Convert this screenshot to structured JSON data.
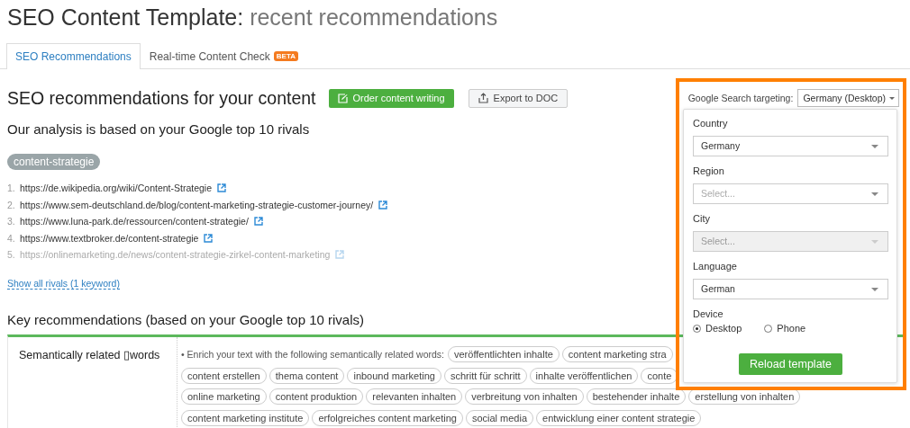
{
  "page_title": {
    "main": "SEO Content Template:",
    "sub": "recent recommendations"
  },
  "tabs": [
    {
      "label": "SEO Recommendations",
      "selected": true
    },
    {
      "label": "Real-time Content Check",
      "selected": false,
      "badge": "BETA"
    }
  ],
  "heading": "SEO recommendations for your content",
  "buttons": {
    "order": "Order content writing",
    "export": "Export to DOC"
  },
  "targeting": {
    "label": "Google Search targeting:",
    "value": "Germany (Desktop)"
  },
  "analysis_title": "Our analysis is based on your Google top 10 rivals",
  "keyword": "content-strategie",
  "rivals": [
    {
      "number": "1.",
      "url": "https://de.wikipedia.org/wiki/Content-Strategie",
      "faded": false
    },
    {
      "number": "2.",
      "url": "https://www.sem-deutschland.de/blog/content-marketing-strategie-customer-journey/",
      "faded": false
    },
    {
      "number": "3.",
      "url": "https://www.luna-park.de/ressourcen/content-strategie/",
      "faded": false
    },
    {
      "number": "4.",
      "url": "https://www.textbroker.de/content-strategie",
      "faded": false
    },
    {
      "number": "5.",
      "url": "https://onlinemarketing.de/news/content-strategie-zirkel-content-marketing",
      "faded": true
    }
  ],
  "show_all": "Show all rivals (1 keyword)",
  "key_title": "Key recommendations (based on your Google top 10 rivals)",
  "recommendation": {
    "label": "Semantically related ▯words",
    "intro": "• Enrich your text with the following semantically related words:",
    "tag_rows": [
      [
        "veröffentlichten inhalte",
        "content marketing stra"
      ],
      [
        "content erstellen",
        "thema content",
        "inbound marketing",
        "schritt für schritt",
        "inhalte veröffentlichen",
        "conte"
      ],
      [
        "online marketing",
        "content produktion",
        "relevanten inhalten",
        "verbreitung von inhalten",
        "bestehender inhalte",
        "erstellung von inhalten"
      ],
      [
        "content marketing institute",
        "erfolgreiches content marketing",
        "social media",
        "entwicklung einer content strategie"
      ]
    ]
  },
  "popup": {
    "fields": [
      {
        "label": "Country",
        "value": "Germany",
        "disabled": false
      },
      {
        "label": "Region",
        "placeholder": "Select...",
        "disabled": false
      },
      {
        "label": "City",
        "placeholder": "Select...",
        "disabled": true
      },
      {
        "label": "Language",
        "value": "German",
        "disabled": false
      }
    ],
    "device_label": "Device",
    "devices": [
      {
        "label": "Desktop",
        "selected": true
      },
      {
        "label": "Phone",
        "selected": false
      }
    ],
    "reload": "Reload template"
  }
}
